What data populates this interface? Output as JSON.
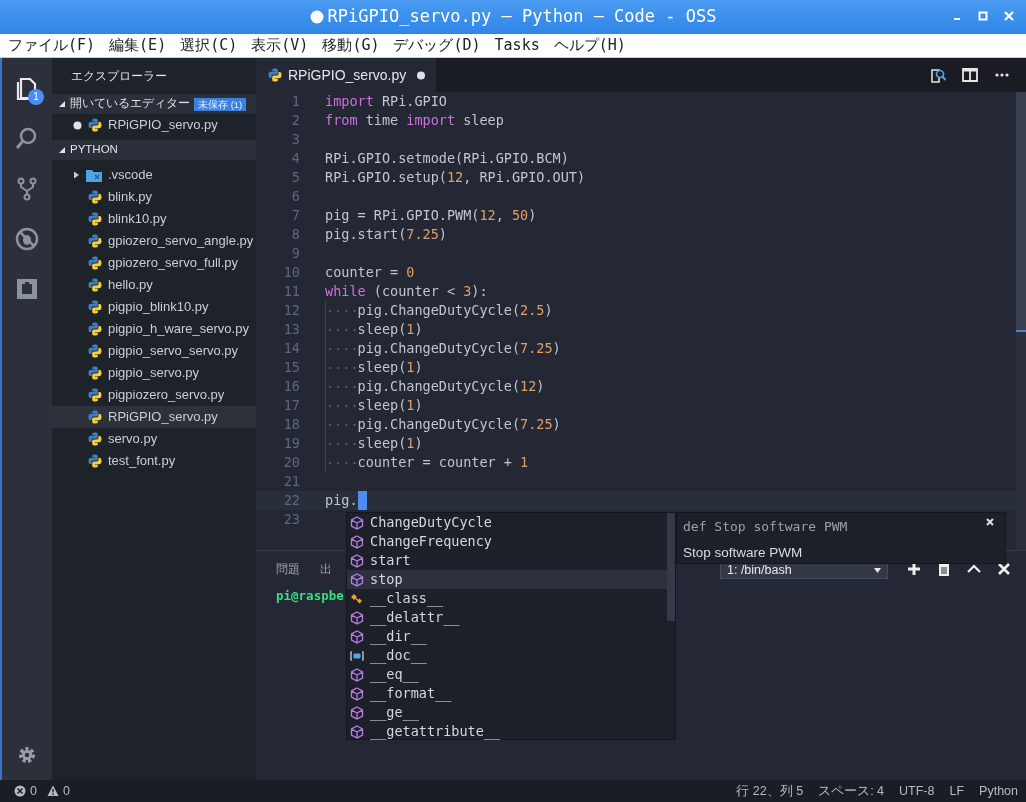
{
  "window": {
    "title": "RPiGPIO_servo.py — Python — Code - OSS",
    "unsaved": true
  },
  "menu": [
    "ファイル(F)",
    "編集(E)",
    "選択(C)",
    "表示(V)",
    "移動(G)",
    "デバッグ(D)",
    "Tasks",
    "ヘルプ(H)"
  ],
  "activity_bar": [
    {
      "kind": "explorer",
      "selected": true,
      "badge": "1"
    },
    {
      "kind": "search",
      "selected": false
    },
    {
      "kind": "scm",
      "selected": false
    },
    {
      "kind": "debug",
      "selected": false
    },
    {
      "kind": "extensions",
      "selected": false
    }
  ],
  "sidebar": {
    "title": "エクスプローラー",
    "open_editors": {
      "label": "開いているエディター",
      "expanded": true,
      "badge": "未保存 (1)",
      "items": [
        {
          "name": "RPiGPIO_servo.py",
          "dirty": true
        }
      ]
    },
    "folder": {
      "label": "PYTHON",
      "expanded": true,
      "children": [
        {
          "name": ".vscode",
          "kind": "folder",
          "expanded": false,
          "selected": false
        },
        {
          "name": "blink.py",
          "kind": "file",
          "selected": false
        },
        {
          "name": "blink10.py",
          "kind": "file",
          "selected": false
        },
        {
          "name": "gpiozero_servo_angle.py",
          "kind": "file",
          "selected": false
        },
        {
          "name": "gpiozero_servo_full.py",
          "kind": "file",
          "selected": false
        },
        {
          "name": "hello.py",
          "kind": "file",
          "selected": false
        },
        {
          "name": "pigpio_blink10.py",
          "kind": "file",
          "selected": false
        },
        {
          "name": "pigpio_h_ware_servo.py",
          "kind": "file",
          "selected": false
        },
        {
          "name": "pigpio_servo_servo.py",
          "kind": "file",
          "selected": false
        },
        {
          "name": "pigpio_servo.py",
          "kind": "file",
          "selected": false
        },
        {
          "name": "pigpiozero_servo.py",
          "kind": "file",
          "selected": false
        },
        {
          "name": "RPiGPIO_servo.py",
          "kind": "file",
          "selected": true
        },
        {
          "name": "servo.py",
          "kind": "file",
          "selected": false
        },
        {
          "name": "test_font.py",
          "kind": "file",
          "selected": false
        }
      ]
    }
  },
  "editor": {
    "tabs": [
      {
        "label": "RPiGPIO_servo.py",
        "dirty": true,
        "selected": true
      }
    ],
    "lines": [
      {
        "number": "1",
        "indent": false,
        "active": false,
        "tokens": [
          {
            "kind": "kw",
            "text": "import"
          },
          {
            "kind": "txt",
            "text": " RPi.GPIO"
          }
        ]
      },
      {
        "number": "2",
        "indent": false,
        "active": false,
        "tokens": [
          {
            "kind": "kw",
            "text": "from"
          },
          {
            "kind": "txt",
            "text": " time "
          },
          {
            "kind": "kw",
            "text": "import"
          },
          {
            "kind": "txt",
            "text": " sleep"
          }
        ]
      },
      {
        "number": "3",
        "indent": false,
        "active": false
      },
      {
        "number": "4",
        "indent": false,
        "active": false,
        "tokens": [
          {
            "kind": "txt",
            "text": "RPi.GPIO.setmode(RPi.GPIO.BCM)"
          }
        ]
      },
      {
        "number": "5",
        "indent": false,
        "active": false,
        "tokens": [
          {
            "kind": "txt",
            "text": "RPi.GPIO.setup("
          },
          {
            "kind": "num",
            "text": "12"
          },
          {
            "kind": "txt",
            "text": ", RPi.GPIO.OUT)"
          }
        ]
      },
      {
        "number": "6",
        "indent": false,
        "active": false
      },
      {
        "number": "7",
        "indent": false,
        "active": false,
        "tokens": [
          {
            "kind": "txt",
            "text": "pig = RPi.GPIO.PWM("
          },
          {
            "kind": "num",
            "text": "12"
          },
          {
            "kind": "txt",
            "text": ", "
          },
          {
            "kind": "num",
            "text": "50"
          },
          {
            "kind": "txt",
            "text": ")"
          }
        ]
      },
      {
        "number": "8",
        "indent": false,
        "active": false,
        "tokens": [
          {
            "kind": "txt",
            "text": "pig.start("
          },
          {
            "kind": "num",
            "text": "7.25"
          },
          {
            "kind": "txt",
            "text": ")"
          }
        ]
      },
      {
        "number": "9",
        "indent": false,
        "active": false
      },
      {
        "number": "10",
        "indent": false,
        "active": false,
        "tokens": [
          {
            "kind": "txt",
            "text": "counter = "
          },
          {
            "kind": "num",
            "text": "0"
          }
        ]
      },
      {
        "number": "11",
        "indent": false,
        "active": false,
        "tokens": [
          {
            "kind": "kw",
            "text": "while"
          },
          {
            "kind": "txt",
            "text": " (counter < "
          },
          {
            "kind": "num",
            "text": "3"
          },
          {
            "kind": "txt",
            "text": "):"
          }
        ]
      },
      {
        "number": "12",
        "indent": true,
        "active": false,
        "tokens": [
          {
            "kind": "txt",
            "text": "pig.ChangeDutyCycle("
          },
          {
            "kind": "num",
            "text": "2.5"
          },
          {
            "kind": "txt",
            "text": ")"
          }
        ]
      },
      {
        "number": "13",
        "indent": true,
        "active": false,
        "tokens": [
          {
            "kind": "txt",
            "text": "sleep("
          },
          {
            "kind": "num",
            "text": "1"
          },
          {
            "kind": "txt",
            "text": ")"
          }
        ]
      },
      {
        "number": "14",
        "indent": true,
        "active": false,
        "tokens": [
          {
            "kind": "txt",
            "text": "pig.ChangeDutyCycle("
          },
          {
            "kind": "num",
            "text": "7.25"
          },
          {
            "kind": "txt",
            "text": ")"
          }
        ]
      },
      {
        "number": "15",
        "indent": true,
        "active": false,
        "tokens": [
          {
            "kind": "txt",
            "text": "sleep("
          },
          {
            "kind": "num",
            "text": "1"
          },
          {
            "kind": "txt",
            "text": ")"
          }
        ]
      },
      {
        "number": "16",
        "indent": true,
        "active": false,
        "tokens": [
          {
            "kind": "txt",
            "text": "pig.ChangeDutyCycle("
          },
          {
            "kind": "num",
            "text": "12"
          },
          {
            "kind": "txt",
            "text": ")"
          }
        ]
      },
      {
        "number": "17",
        "indent": true,
        "active": false,
        "tokens": [
          {
            "kind": "txt",
            "text": "sleep("
          },
          {
            "kind": "num",
            "text": "1"
          },
          {
            "kind": "txt",
            "text": ")"
          }
        ]
      },
      {
        "number": "18",
        "indent": true,
        "active": false,
        "tokens": [
          {
            "kind": "txt",
            "text": "pig.ChangeDutyCycle("
          },
          {
            "kind": "num",
            "text": "7.25"
          },
          {
            "kind": "txt",
            "text": ")"
          }
        ]
      },
      {
        "number": "19",
        "indent": true,
        "active": false,
        "tokens": [
          {
            "kind": "txt",
            "text": "sleep("
          },
          {
            "kind": "num",
            "text": "1"
          },
          {
            "kind": "txt",
            "text": ")"
          }
        ]
      },
      {
        "number": "20",
        "indent": true,
        "active": false,
        "tokens": [
          {
            "kind": "txt",
            "text": "counter = counter + "
          },
          {
            "kind": "num",
            "text": "1"
          }
        ]
      },
      {
        "number": "21",
        "indent": false,
        "active": false
      },
      {
        "number": "22",
        "indent": false,
        "active": true,
        "tokens": [
          {
            "kind": "txt",
            "text": "pig."
          }
        ]
      },
      {
        "number": "23",
        "indent": false,
        "active": false
      }
    ]
  },
  "suggest": {
    "items": [
      {
        "label": "ChangeDutyCycle",
        "kind": "method",
        "selected": false
      },
      {
        "label": "ChangeFrequency",
        "kind": "method",
        "selected": false
      },
      {
        "label": "start",
        "kind": "method",
        "selected": false
      },
      {
        "label": "stop",
        "kind": "method",
        "selected": true
      },
      {
        "label": "__class__",
        "kind": "class",
        "selected": false
      },
      {
        "label": "__delattr__",
        "kind": "method",
        "selected": false
      },
      {
        "label": "__dir__",
        "kind": "method",
        "selected": false
      },
      {
        "label": "__doc__",
        "kind": "field",
        "selected": false
      },
      {
        "label": "__eq__",
        "kind": "method",
        "selected": false
      },
      {
        "label": "__format__",
        "kind": "method",
        "selected": false
      },
      {
        "label": "__ge__",
        "kind": "method",
        "selected": false
      },
      {
        "label": "__getattribute__",
        "kind": "method",
        "selected": false
      }
    ],
    "details": {
      "signature": "def Stop software PWM",
      "doc": "Stop software PWM"
    }
  },
  "panel": {
    "tabs": [
      {
        "label": "問題",
        "selected": false
      },
      {
        "label": "出",
        "selected": false
      }
    ],
    "terminal_select": "1: /bin/bash",
    "prompt": "pi@raspbe"
  },
  "status_bar": {
    "errors": "0",
    "warnings": "0",
    "items": [
      "行 22、列 5",
      "スペース: 4",
      "UTF-8",
      "LF",
      "Python"
    ]
  }
}
